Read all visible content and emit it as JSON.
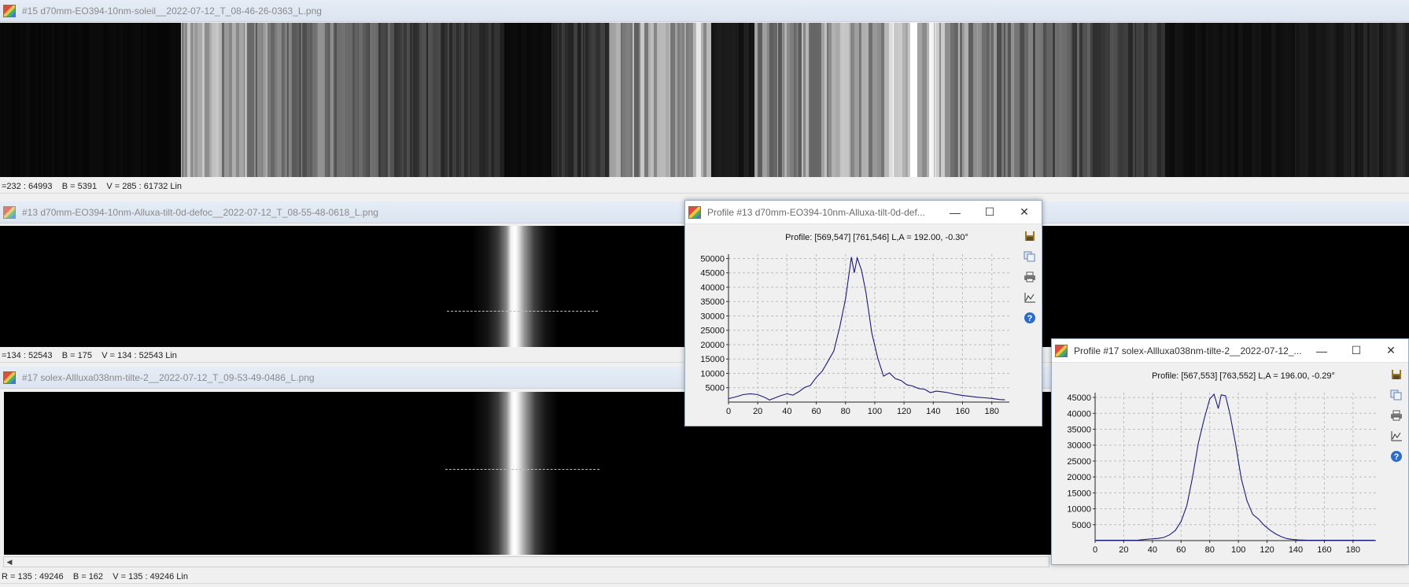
{
  "windows": [
    {
      "title": "#15 d70mm-EO394-10nm-soleil__2022-07-12_T_08-46-26-0363_L.png",
      "status": "=232 : 64993    B = 5391    V = 285 : 61732 Lin"
    },
    {
      "title": "#13 d70mm-EO394-10nm-Alluxa-tilt-0d-defoc__2022-07-12_T_08-55-48-0618_L.png",
      "status": "=134 : 52543    B = 175    V = 134 : 52543 Lin"
    },
    {
      "title": "#17 solex-Allluxa038nm-tilte-2__2022-07-12_T_09-53-49-0486_L.png",
      "status": "R = 135 : 49246    B = 162    V = 135 : 49246 Lin"
    }
  ],
  "profiles": [
    {
      "title": "Profile #13 d70mm-EO394-10nm-Alluxa-tilt-0d-def...",
      "header": "Profile: [569,547] [761,546]  L,A = 192.00, -0.30°",
      "xticks": [
        "0",
        "20",
        "40",
        "60",
        "80",
        "100",
        "120",
        "140",
        "160",
        "180"
      ],
      "yticks": [
        "5000",
        "10000",
        "15000",
        "20000",
        "25000",
        "30000",
        "35000",
        "40000",
        "45000",
        "50000"
      ],
      "xlim": [
        0,
        192
      ],
      "ylim": [
        0,
        51500
      ],
      "values": [
        [
          0,
          1200
        ],
        [
          5,
          1800
        ],
        [
          10,
          2600
        ],
        [
          15,
          2900
        ],
        [
          20,
          2600
        ],
        [
          25,
          1600
        ],
        [
          28,
          700
        ],
        [
          32,
          1500
        ],
        [
          36,
          2300
        ],
        [
          40,
          2900
        ],
        [
          44,
          2400
        ],
        [
          48,
          3600
        ],
        [
          52,
          5100
        ],
        [
          56,
          5800
        ],
        [
          60,
          8600
        ],
        [
          64,
          10700
        ],
        [
          68,
          14200
        ],
        [
          72,
          17800
        ],
        [
          76,
          26000
        ],
        [
          80,
          36000
        ],
        [
          84,
          50500
        ],
        [
          86,
          45000
        ],
        [
          88,
          50200
        ],
        [
          91,
          45800
        ],
        [
          94,
          38000
        ],
        [
          98,
          24000
        ],
        [
          102,
          15300
        ],
        [
          106,
          9000
        ],
        [
          110,
          10200
        ],
        [
          114,
          8200
        ],
        [
          118,
          7500
        ],
        [
          122,
          6000
        ],
        [
          126,
          5600
        ],
        [
          130,
          4700
        ],
        [
          134,
          4500
        ],
        [
          138,
          3300
        ],
        [
          142,
          3800
        ],
        [
          146,
          3600
        ],
        [
          150,
          3300
        ],
        [
          155,
          2700
        ],
        [
          160,
          2300
        ],
        [
          165,
          2000
        ],
        [
          170,
          1700
        ],
        [
          175,
          1500
        ],
        [
          180,
          1300
        ],
        [
          185,
          900
        ],
        [
          189,
          800
        ]
      ],
      "tools": [
        "save-icon",
        "copy-icon",
        "print-icon",
        "chart-options-icon",
        "help-icon"
      ]
    },
    {
      "title": "Profile #17 solex-Allluxa038nm-tilte-2__2022-07-12_...",
      "header": "Profile: [567,553] [763,552]  L,A = 196.00, -0.29°",
      "xticks": [
        "0",
        "20",
        "40",
        "60",
        "80",
        "100",
        "120",
        "140",
        "160",
        "180"
      ],
      "yticks": [
        "5000",
        "10000",
        "15000",
        "20000",
        "25000",
        "30000",
        "35000",
        "40000",
        "45000"
      ],
      "xlim": [
        0,
        196
      ],
      "ylim": [
        0,
        46500
      ],
      "values": [
        [
          0,
          100
        ],
        [
          10,
          100
        ],
        [
          20,
          120
        ],
        [
          30,
          150
        ],
        [
          38,
          500
        ],
        [
          44,
          700
        ],
        [
          48,
          1000
        ],
        [
          52,
          1800
        ],
        [
          56,
          3200
        ],
        [
          60,
          6000
        ],
        [
          64,
          11000
        ],
        [
          68,
          20000
        ],
        [
          72,
          30500
        ],
        [
          76,
          38000
        ],
        [
          80,
          44500
        ],
        [
          83,
          46000
        ],
        [
          86,
          41500
        ],
        [
          88,
          45800
        ],
        [
          91,
          45500
        ],
        [
          94,
          40000
        ],
        [
          98,
          30500
        ],
        [
          102,
          19500
        ],
        [
          106,
          12500
        ],
        [
          110,
          8200
        ],
        [
          114,
          6800
        ],
        [
          118,
          4800
        ],
        [
          122,
          3300
        ],
        [
          126,
          2100
        ],
        [
          130,
          1200
        ],
        [
          134,
          600
        ],
        [
          138,
          350
        ],
        [
          142,
          200
        ],
        [
          148,
          120
        ],
        [
          160,
          100
        ],
        [
          175,
          100
        ],
        [
          190,
          100
        ],
        [
          195,
          100
        ]
      ],
      "tools": [
        "save-icon",
        "copy-icon",
        "print-icon",
        "chart-options-icon",
        "help-icon"
      ]
    }
  ],
  "window_controls": {
    "minimize": "—",
    "maximize": "☐",
    "close": "✕"
  },
  "scroll_arrow": "◀"
}
